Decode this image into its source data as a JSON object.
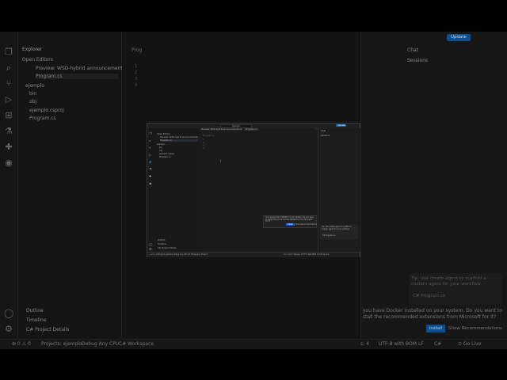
{
  "explorer": {
    "title": "Explorer",
    "open_editors": "Open Editors",
    "open_files": [
      "Preview: WSD-hybrid announcement...",
      "Program.cs"
    ],
    "folder": "ejemplo",
    "tree": [
      "bin",
      "obj",
      "ejemplo.csproj",
      "Program.cs"
    ],
    "outline": "Outline",
    "timeline": "Timeline",
    "solution": "C# Project Details"
  },
  "editor": {
    "tab": "Prog",
    "lines": [
      "1",
      "2",
      "3",
      "4"
    ]
  },
  "chat": {
    "title": "Chat",
    "sessions": "Sessions",
    "update_button": "Update",
    "tip": "Tip: Use create-agent to scaffold a custom agent for your workflow.",
    "attachment": "C# Program.cs"
  },
  "notification": {
    "message": "...you have Docker installed on your system. Do you want to install the recommended extensions from Microsoft for it?",
    "line1": "you have Docker installed on your system. Do you want to",
    "line2": "stall the recommended extensions from Microsoft for it?",
    "install": "Install",
    "show": "Show Recommendations"
  },
  "status": {
    "left": "⊗ 0  ⚠ 0",
    "project": "Projects: ejemplo",
    "debug": "Debug Any CPU",
    "workspace": "C# Workspace",
    "spaces": "s: 4",
    "encoding": "UTF-8 with BOM",
    "eol": "LF",
    "lang": "C#",
    "golive": "⊙ Go Live"
  },
  "mini": {
    "search": "ejemplo",
    "tab1": "Preview: WSD-hybrid announcement.md",
    "tab2": "Program.cs",
    "update": "Update",
    "chat": "Chat",
    "sessions": "Sessions",
    "open_editors": "Open Editors",
    "files": [
      "Preview: WSD-hybrid announcement...",
      "Program.cs"
    ],
    "folder": "ejemplo",
    "tree": [
      "bin",
      "obj",
      "ejemplo.csproj",
      "Program.cs"
    ],
    "outline": "Outline",
    "timeline": "Timeline",
    "csproj": "C# Project Details",
    "notif": "You have Docker installed on your system. Do you want to install the recommended extensions from Microsoft for it?",
    "install": "Install",
    "show": "Show Recommendations",
    "tip": "Tip: Use create-agent to scaffold a custom agent for your workflow.",
    "attachment": "C# Program.cs",
    "status": "Ln 1, Col 1   Spaces: 4   UTF-8 with BOM   LF   C#   Go Live",
    "status_left": "⊗ 0 ⚠ 0   Projects: ejemplo   Debug Any CPU   C# Workspace: Project"
  }
}
